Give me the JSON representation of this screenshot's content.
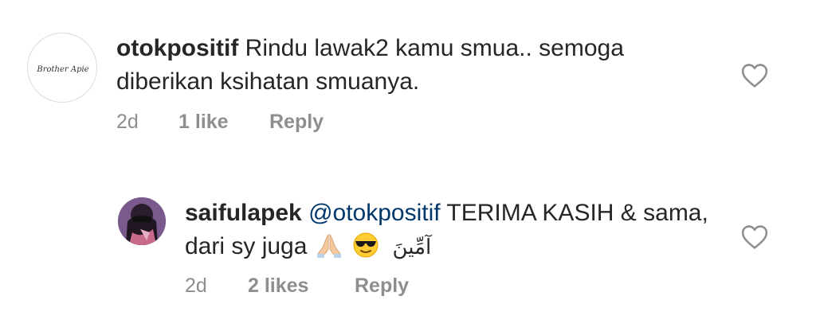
{
  "comments": [
    {
      "username": "otokpositif",
      "avatar_text": "Brother Apie",
      "text": "Rindu lawak2 kamu smua.. semoga diberikan ksihatan smuanya.",
      "time": "2d",
      "likes": "1 like",
      "reply_label": "Reply",
      "like_icon": "heart-outline-icon"
    },
    {
      "username": "saifulapek",
      "mention": "@otokpositif",
      "text": "TERIMA KASIH & sama, dari sy juga",
      "emojis": [
        "folded-hands-emoji",
        "sunglasses-emoji"
      ],
      "arabic": "آمِّينَ",
      "time": "2d",
      "likes": "2 likes",
      "reply_label": "Reply",
      "like_icon": "heart-outline-icon"
    }
  ],
  "colors": {
    "text": "#262626",
    "secondary": "#8e8e8e",
    "mention": "#00376b",
    "border": "#dbdbdb"
  }
}
